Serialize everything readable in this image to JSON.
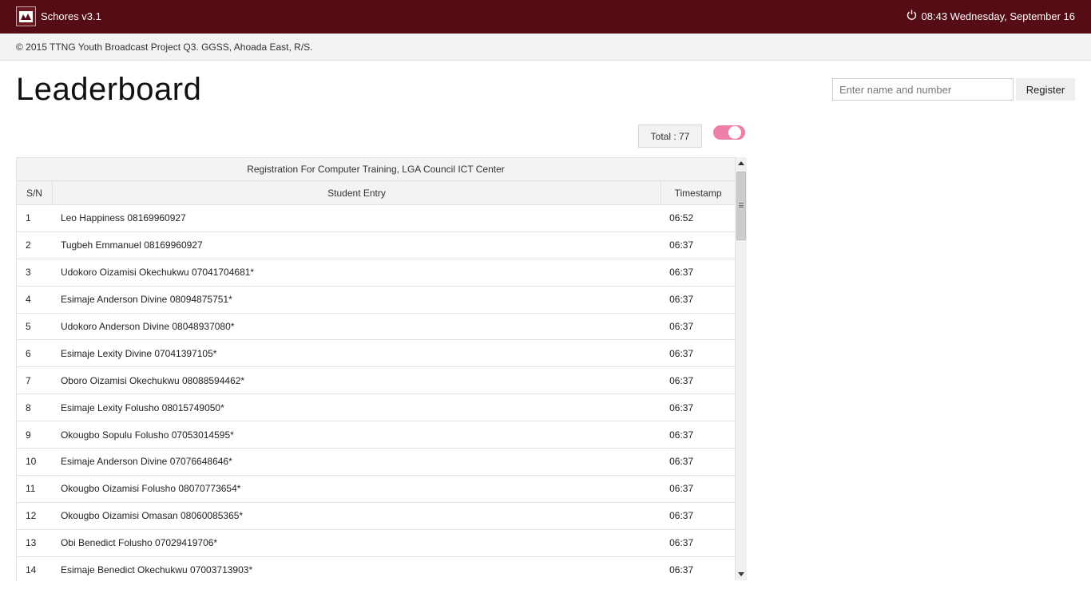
{
  "app": {
    "title": "Schores v3.1",
    "logo_icon": "app-logo-icon",
    "power_icon": "power-icon",
    "datetime": "08:43 Wednesday, September 16"
  },
  "colors": {
    "titlebar": "#550c14",
    "toggle": "#ee7fa9"
  },
  "copyright": "© 2015 TTNG Youth Broadcast Project Q3. GGSS, Ahoada East, R/S.",
  "page": {
    "title": "Leaderboard"
  },
  "register": {
    "placeholder": "Enter name and number",
    "value": "",
    "button_label": "Register"
  },
  "total": {
    "label": "Total : 77",
    "toggle_on": true
  },
  "table": {
    "caption": "Registration For Computer Training, LGA Council ICT Center",
    "headers": {
      "sn": "S/N",
      "entry": "Student Entry",
      "timestamp": "Timestamp"
    },
    "rows": [
      {
        "sn": "1",
        "entry": "Leo Happiness 08169960927",
        "time": "06:52"
      },
      {
        "sn": "2",
        "entry": "Tugbeh Emmanuel 08169960927",
        "time": "06:37"
      },
      {
        "sn": "3",
        "entry": "Udokoro Oizamisi Okechukwu 07041704681*",
        "time": "06:37"
      },
      {
        "sn": "4",
        "entry": "Esimaje Anderson Divine 08094875751*",
        "time": "06:37"
      },
      {
        "sn": "5",
        "entry": "Udokoro Anderson Divine 08048937080*",
        "time": "06:37"
      },
      {
        "sn": "6",
        "entry": "Esimaje Lexity Divine 07041397105*",
        "time": "06:37"
      },
      {
        "sn": "7",
        "entry": "Oboro Oizamisi Okechukwu 08088594462*",
        "time": "06:37"
      },
      {
        "sn": "8",
        "entry": "Esimaje Lexity Folusho 08015749050*",
        "time": "06:37"
      },
      {
        "sn": "9",
        "entry": "Okougbo Sopulu Folusho 07053014595*",
        "time": "06:37"
      },
      {
        "sn": "10",
        "entry": "Esimaje Anderson Divine 07076648646*",
        "time": "06:37"
      },
      {
        "sn": "11",
        "entry": "Okougbo Oizamisi Folusho 08070773654*",
        "time": "06:37"
      },
      {
        "sn": "12",
        "entry": "Okougbo Oizamisi Omasan 08060085365*",
        "time": "06:37"
      },
      {
        "sn": "13",
        "entry": "Obi Benedict Folusho 07029419706*",
        "time": "06:37"
      },
      {
        "sn": "14",
        "entry": "Esimaje Benedict Okechukwu 07003713903*",
        "time": "06:37"
      }
    ]
  }
}
